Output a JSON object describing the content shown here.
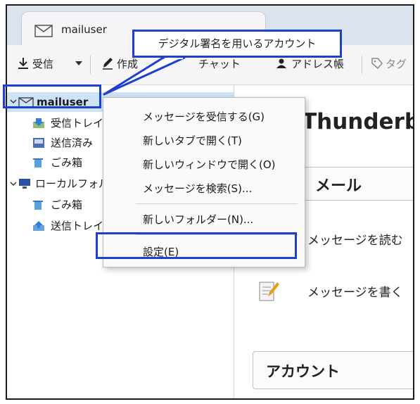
{
  "tab": {
    "label": "mailuser",
    "icon": "mail-icon"
  },
  "toolbar": {
    "get_messages": "受信",
    "write": "作成",
    "chat": "チャット",
    "address_book": "アドレス帳",
    "tag": "タグ"
  },
  "callout": {
    "text": "デジタル署名を用いるアカウント"
  },
  "sidebar": {
    "account": "mailuser",
    "folders": [
      {
        "label": "受信トレイ",
        "icon": "inbox-icon"
      },
      {
        "label": "送信済み",
        "icon": "sent-folder-icon"
      },
      {
        "label": "ごみ箱",
        "icon": "trash-icon"
      }
    ],
    "local_folders": "ローカルフォルダー",
    "local_items": [
      {
        "label": "ごみ箱",
        "icon": "trash-icon"
      },
      {
        "label": "送信トレイ",
        "icon": "outbox-icon"
      }
    ]
  },
  "content": {
    "title": "Thunderbird Mail",
    "section": "メール",
    "actions": [
      {
        "label": "メッセージを読む",
        "icon": "read-icon"
      },
      {
        "label": "メッセージを書く",
        "icon": "write-icon"
      }
    ],
    "accounts_header": "アカウント"
  },
  "context_menu": {
    "items": [
      "メッセージを受信する(G)",
      "新しいタブで開く(T)",
      "新しいウィンドウで開く(O)",
      "メッセージを検索(S)...",
      "新しいフォルダー(N)...",
      "設定(E)"
    ]
  },
  "colors": {
    "highlight_border": "#1f3fcf",
    "selected_row": "#cfe3f7"
  }
}
